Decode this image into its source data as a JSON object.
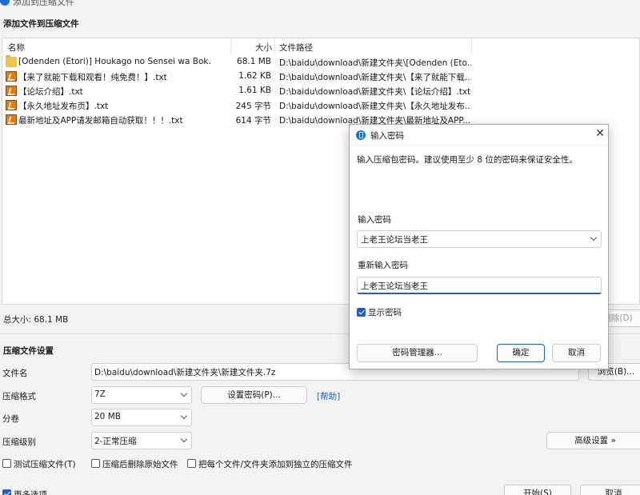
{
  "window": {
    "title": "添加到压缩文件"
  },
  "list_section": {
    "title": "添加文件到压缩文件"
  },
  "file_list": {
    "columns": {
      "name": "名称",
      "size": "大小",
      "path": "文件路径"
    },
    "rows": [
      {
        "icon": "folder-icon",
        "name": "[Odenden (Etori)] Houkago no Sensei wa Bok...",
        "size": "68.1 MB",
        "path": "D:\\baidu\\download\\新建文件夹\\[Odenden (Eto..."
      },
      {
        "icon": "txt-file-icon",
        "name": "【来了就能下载和观看！纯免费！】.txt",
        "size": "1.62 KB",
        "path": "D:\\baidu\\download\\新建文件夹\\【来了就能下载..."
      },
      {
        "icon": "txt-file-icon",
        "name": "【论坛介绍】.txt",
        "size": "1.61 KB",
        "path": "D:\\baidu\\download\\新建文件夹\\【论坛介绍】.txt"
      },
      {
        "icon": "txt-file-icon",
        "name": "【永久地址发布页】.txt",
        "size": "245 字节",
        "path": "D:\\baidu\\download\\新建文件夹\\【永久地址发布..."
      },
      {
        "icon": "txt-file-icon",
        "name": "最新地址及APP请发邮箱自动获取！！！.txt",
        "size": "614 字节",
        "path": "D:\\baidu\\download\\新建文件夹\\最新地址及APP..."
      }
    ]
  },
  "total_size": "总大小: 68.1 MB",
  "delete_button_label": "删除(D)",
  "settings": {
    "title": "压缩文件设置",
    "filename_label": "文件名",
    "filename_value": "D:\\baidu\\download\\新建文件夹\\新建文件夹.7z",
    "browse_label": "浏览(B)...",
    "format_label": "压缩格式",
    "format_value": "7Z",
    "set_password_label": "设置密码(P)...",
    "help_label": "[帮助]",
    "volume_label": "分卷",
    "volume_value": "20 MB",
    "level_label": "压缩级别",
    "level_value": "2-正常压缩",
    "advanced_label": "高级设置 »",
    "options": {
      "test": "测试压缩文件(T)",
      "delete_after": "压缩后删除原始文件",
      "separate": "把每个文件/文件夹添加到独立的压缩文件"
    },
    "more_options": "更多选项",
    "start_label": "开始(S)",
    "cancel_label": "取消"
  },
  "dialog": {
    "title": "输入密码",
    "description": "输入压缩包密码。建议使用至少 8 位的密码来保证安全性。",
    "password_label": "输入密码",
    "password_value": "上老王论坛当老王",
    "confirm_label": "重新输入密码",
    "confirm_value": "上老王论坛当老王",
    "show_password_label": "显示密码",
    "show_password_checked": true,
    "manager_label": "密码管理器...",
    "ok_label": "确定",
    "cancel_label": "取消"
  },
  "colors": {
    "accent": "#1f5fc4",
    "link": "#1a5fd0"
  }
}
